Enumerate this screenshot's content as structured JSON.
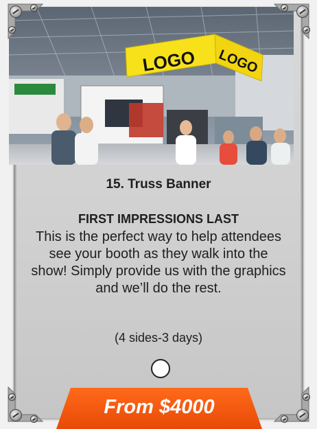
{
  "card": {
    "title": "15. Truss Banner",
    "subtitle": "FIRST IMPRESSIONS LAST",
    "description": "This is the perfect way to help attendees see your booth as they walk into the show! Simply provide us with the graphics and we’ll do the rest.",
    "duration": "(4 sides-3 days)",
    "price": "From $4000"
  },
  "photo": {
    "banner_left_text": "LOGO",
    "banner_right_text": "LOGO"
  },
  "colors": {
    "price_tab": "#f05a12",
    "banner_yellow": "#f7e11a",
    "card_bg": "#d4d4d4"
  },
  "icons": [
    "corner-bracket-icon",
    "screw-icon",
    "carousel-dot-icon"
  ]
}
